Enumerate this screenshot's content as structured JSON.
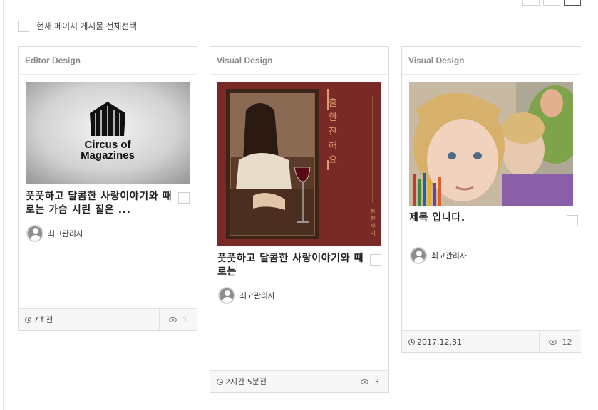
{
  "select_all": {
    "label": "현재 페이지 게시물 전체선택"
  },
  "cards": [
    {
      "category": "Editor Design",
      "image_text": [
        "Circus of",
        "Magazines"
      ],
      "title": "풋풋하고 달콤한 사랑이야기와 때로는 가슴 시린 짙은 ...",
      "author": "최고관리자",
      "date": "7초전",
      "views": "1"
    },
    {
      "category": "Visual Design",
      "image_text": [
        "출",
        "한",
        "잔",
        "해",
        "요"
      ],
      "image_subtext": [
        "한",
        "잔",
        "자",
        "이"
      ],
      "title": "풋풋하고 달콤한 사랑이야기와 때로는",
      "author": "최고관리자",
      "date": "2시간 5분전",
      "views": "3"
    },
    {
      "category": "Visual Design",
      "title": "제목 입니다.",
      "author": "최고관리자",
      "date": "2017.12.31",
      "views": "12"
    }
  ],
  "colors": {
    "book_bg": "#7a2a26",
    "book_accent": "#d9a06a",
    "border": "#dcdcdc"
  }
}
